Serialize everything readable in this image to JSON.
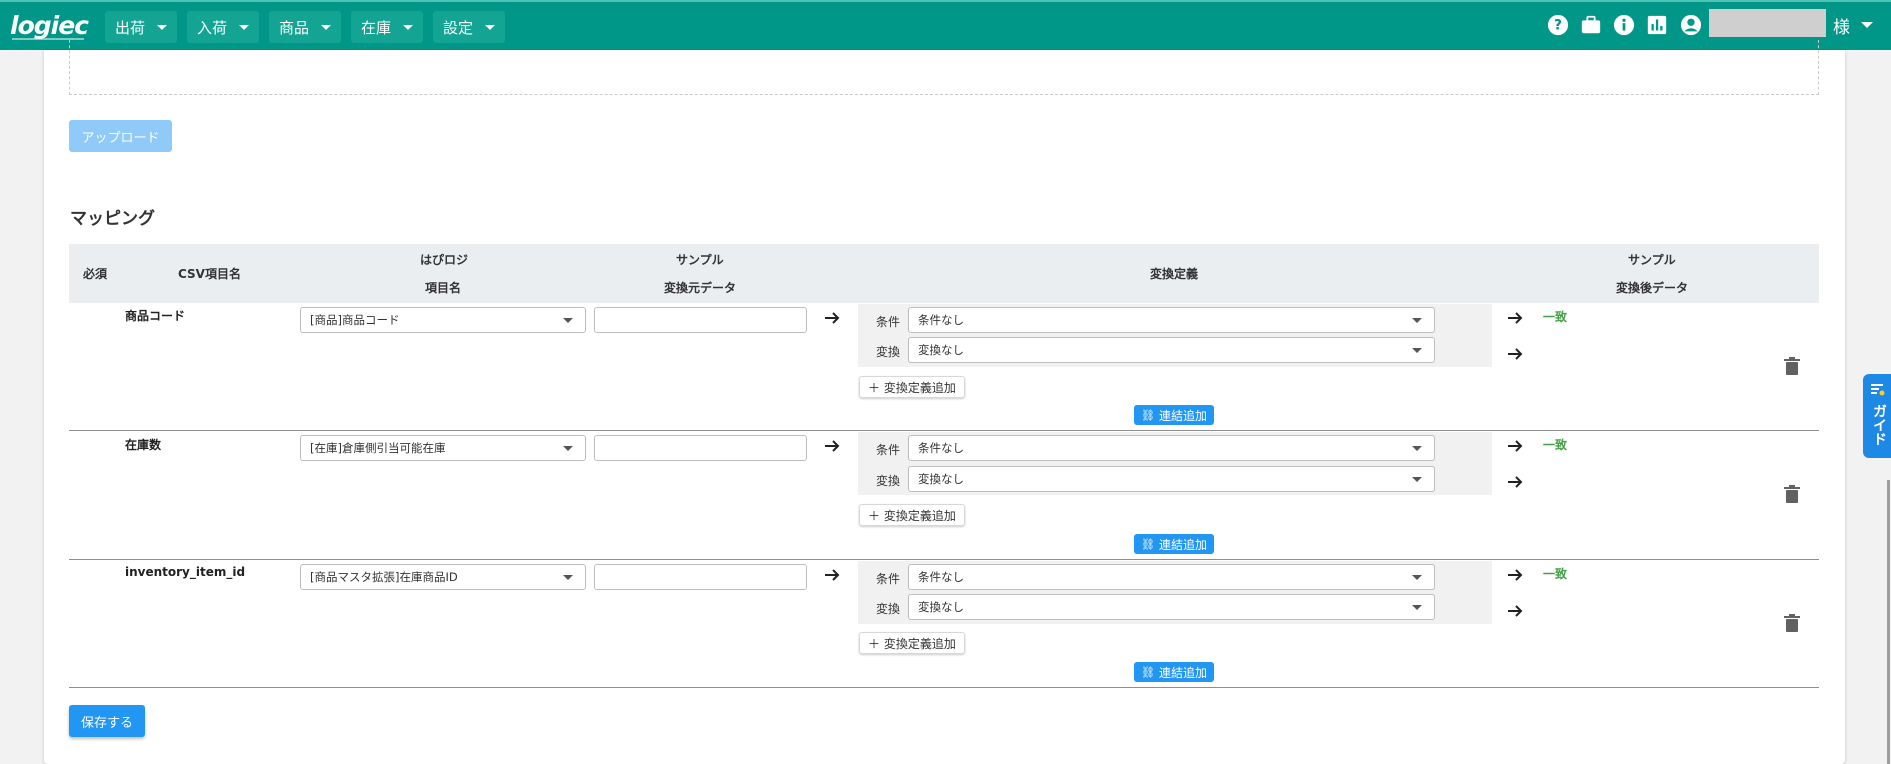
{
  "header": {
    "logo": "logiec",
    "nav": [
      {
        "label": "出荷"
      },
      {
        "label": "入荷"
      },
      {
        "label": "商品"
      },
      {
        "label": "在庫"
      },
      {
        "label": "設定"
      }
    ],
    "icons": [
      "help-icon",
      "briefcase-icon",
      "info-icon",
      "chart-icon",
      "account-icon"
    ],
    "user_suffix": "様"
  },
  "upload": {
    "button_label": "アップロード"
  },
  "mapping": {
    "title": "マッピング",
    "columns": {
      "required": "必須",
      "csv_name": "CSV項目名",
      "habilogi_1": "はぴロジ",
      "habilogi_2": "項目名",
      "sample_src_1": "サンプル",
      "sample_src_2": "変換元データ",
      "conversion": "変換定義",
      "sample_dst_1": "サンプル",
      "sample_dst_2": "変換後データ"
    },
    "rows": [
      {
        "csv_name": "商品コード",
        "field": "[商品]商品コード",
        "condition_label": "条件",
        "condition": "条件なし",
        "convert_label": "変換",
        "convert": "変換なし",
        "result": "一致",
        "add_def": "＋ 変換定義追加",
        "link": "連結追加"
      },
      {
        "csv_name": "在庫数",
        "field": "[在庫]倉庫側引当可能在庫",
        "condition_label": "条件",
        "condition": "条件なし",
        "convert_label": "変換",
        "convert": "変換なし",
        "result": "一致",
        "add_def": "＋ 変換定義追加",
        "link": "連結追加"
      },
      {
        "csv_name": "inventory_item_id",
        "field": "[商品マスタ拡張]在庫商品ID",
        "condition_label": "条件",
        "condition": "条件なし",
        "convert_label": "変換",
        "convert": "変換なし",
        "result": "一致",
        "add_def": "＋ 変換定義追加",
        "link": "連結追加"
      }
    ]
  },
  "save_label": "保存する",
  "guide_label": "ガイド",
  "colors": {
    "header": "#009688",
    "primary": "#2196f3",
    "success": "#43a047"
  }
}
